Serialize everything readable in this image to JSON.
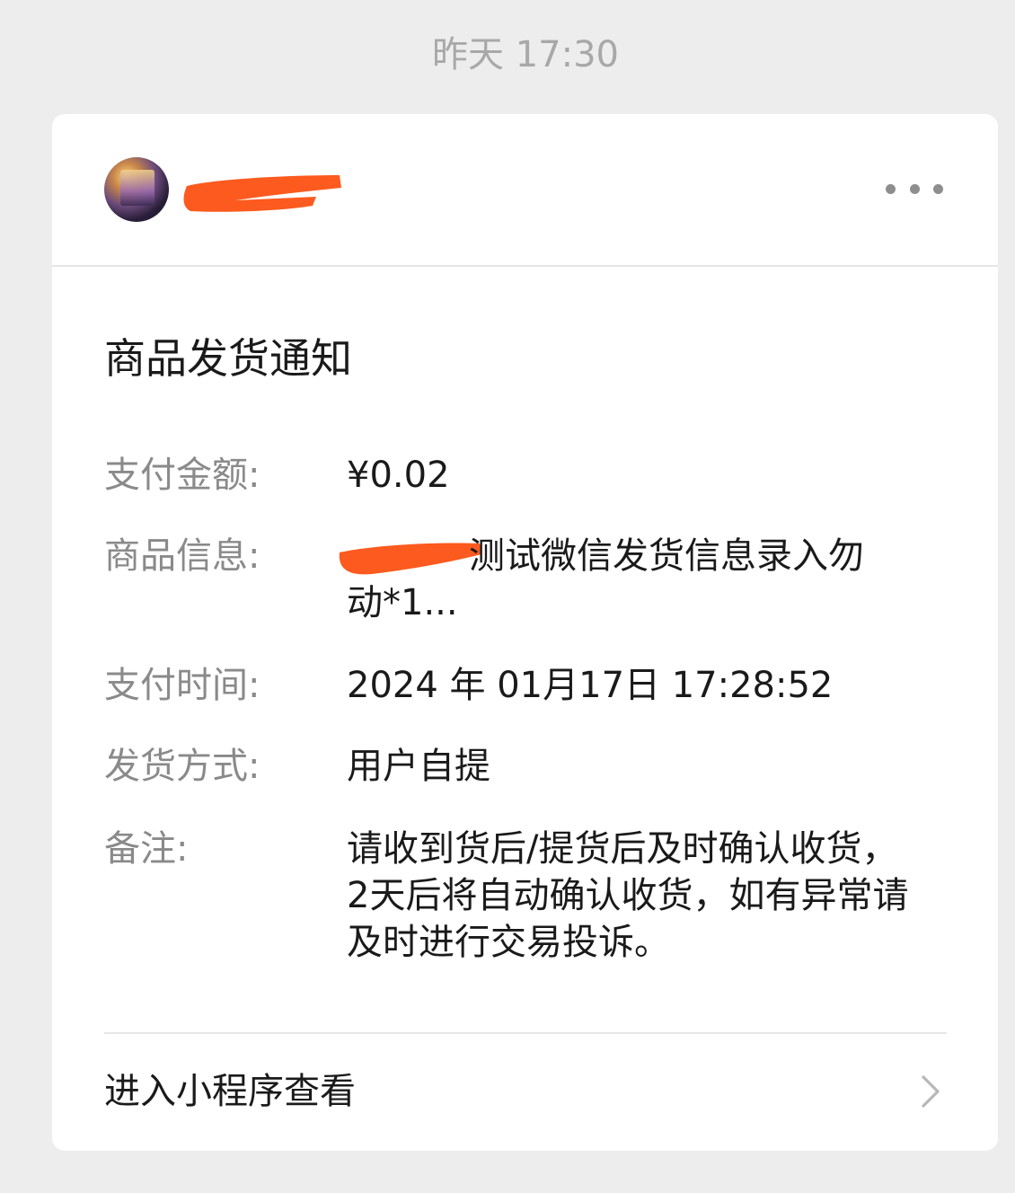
{
  "chat": {
    "timestamp": "昨天 17:30"
  },
  "card": {
    "sender_name": "",
    "title": "商品发货通知",
    "fields": [
      {
        "label": "支付金额:",
        "value": "¥0.02"
      },
      {
        "label": "商品信息:",
        "value_line1": "测试微信发货信息录入勿",
        "value_line2": "动*1..."
      },
      {
        "label": "支付时间:",
        "value": "2024 年 01月17日 17:28:52"
      },
      {
        "label": "发货方式:",
        "value": "用户自提"
      },
      {
        "label": "备注:",
        "value": "请收到货后/提货后及时确认收货，2天后将自动确认收货，如有异常请及时进行交易投诉。"
      }
    ],
    "footer_link": "进入小程序查看"
  },
  "icons": {
    "more": "more-icon",
    "chevron": "chevron-right-icon",
    "avatar": "avatar"
  },
  "colors": {
    "redaction": "#fc5a1e",
    "background": "#ededed",
    "card": "#ffffff",
    "label": "#8a8a8a",
    "text": "#1a1a1a",
    "timestamp": "#a8a8a8"
  }
}
